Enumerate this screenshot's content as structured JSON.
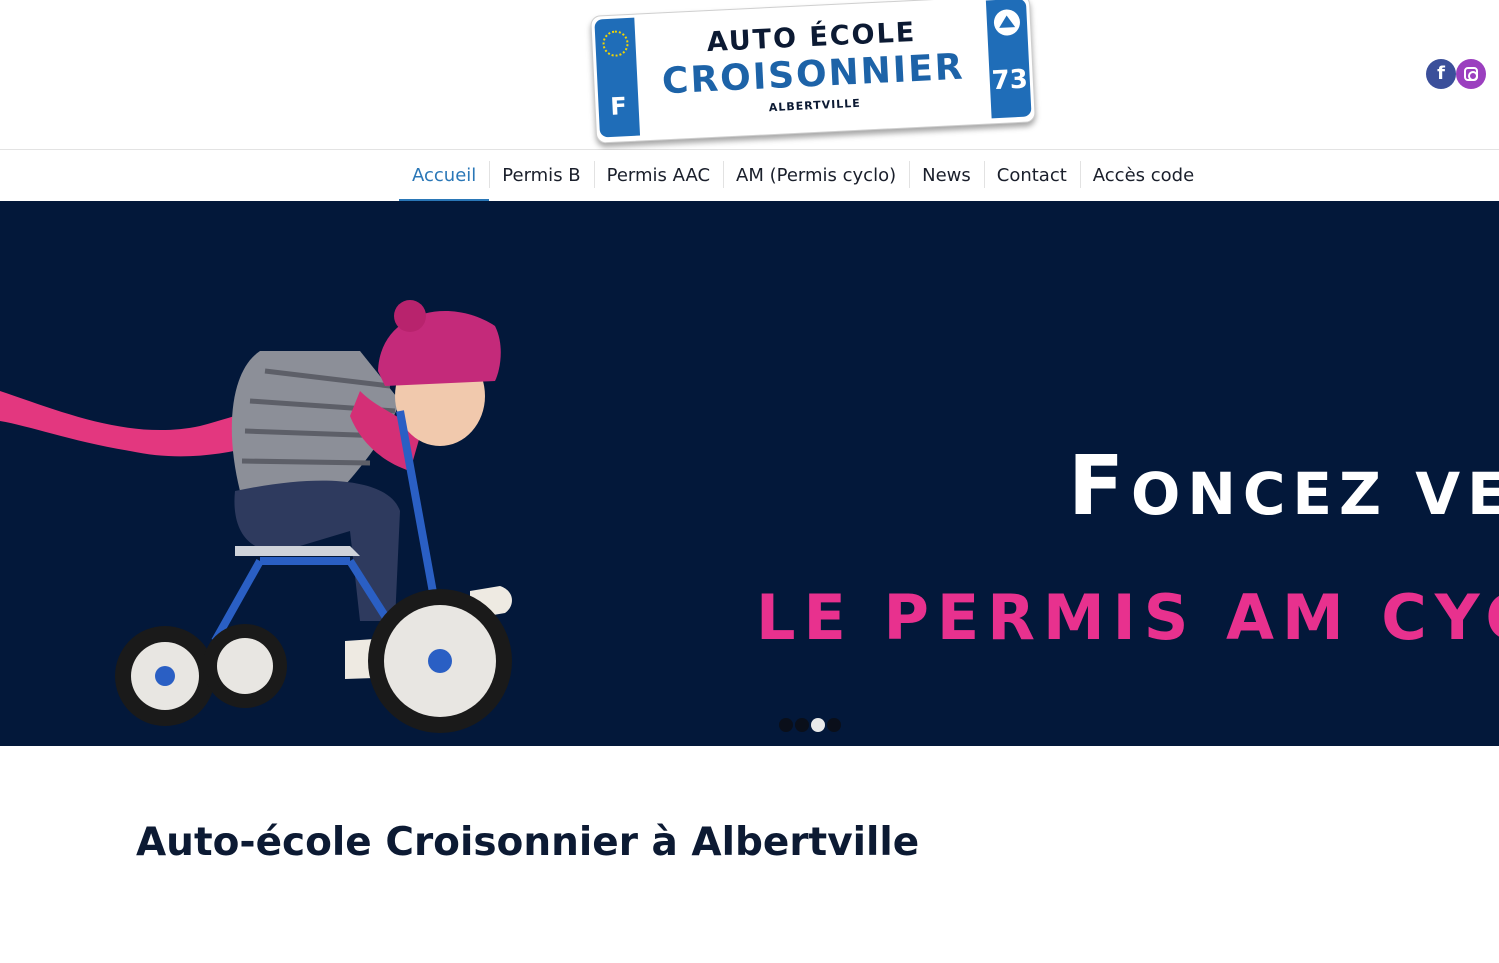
{
  "header": {
    "logo": {
      "line1": "AUTO ÉCOLE",
      "line2": "CROISONNIER",
      "line3": "ALBERTVILLE",
      "country_letter": "F",
      "department": "73"
    },
    "social": [
      {
        "name": "facebook",
        "glyph": "f",
        "color": "#3b4f9a"
      },
      {
        "name": "instagram",
        "color": "#9b3fbf"
      }
    ]
  },
  "nav": {
    "items": [
      {
        "label": "Accueil",
        "active": true
      },
      {
        "label": "Permis B"
      },
      {
        "label": "Permis AAC"
      },
      {
        "label": "AM (Permis cyclo)"
      },
      {
        "label": "News"
      },
      {
        "label": "Contact"
      },
      {
        "label": "Accès code"
      }
    ],
    "accent_color": "#2a77b7"
  },
  "slider": {
    "line1_cap": "F",
    "line1_rest": "ONCEZ VERS",
    "line2": "LE PERMIS AM CYCLO",
    "background": "#03183a",
    "dots_count": 4,
    "active_dot": 3
  },
  "main": {
    "title": "Auto-école Croisonnier à Albertville"
  }
}
